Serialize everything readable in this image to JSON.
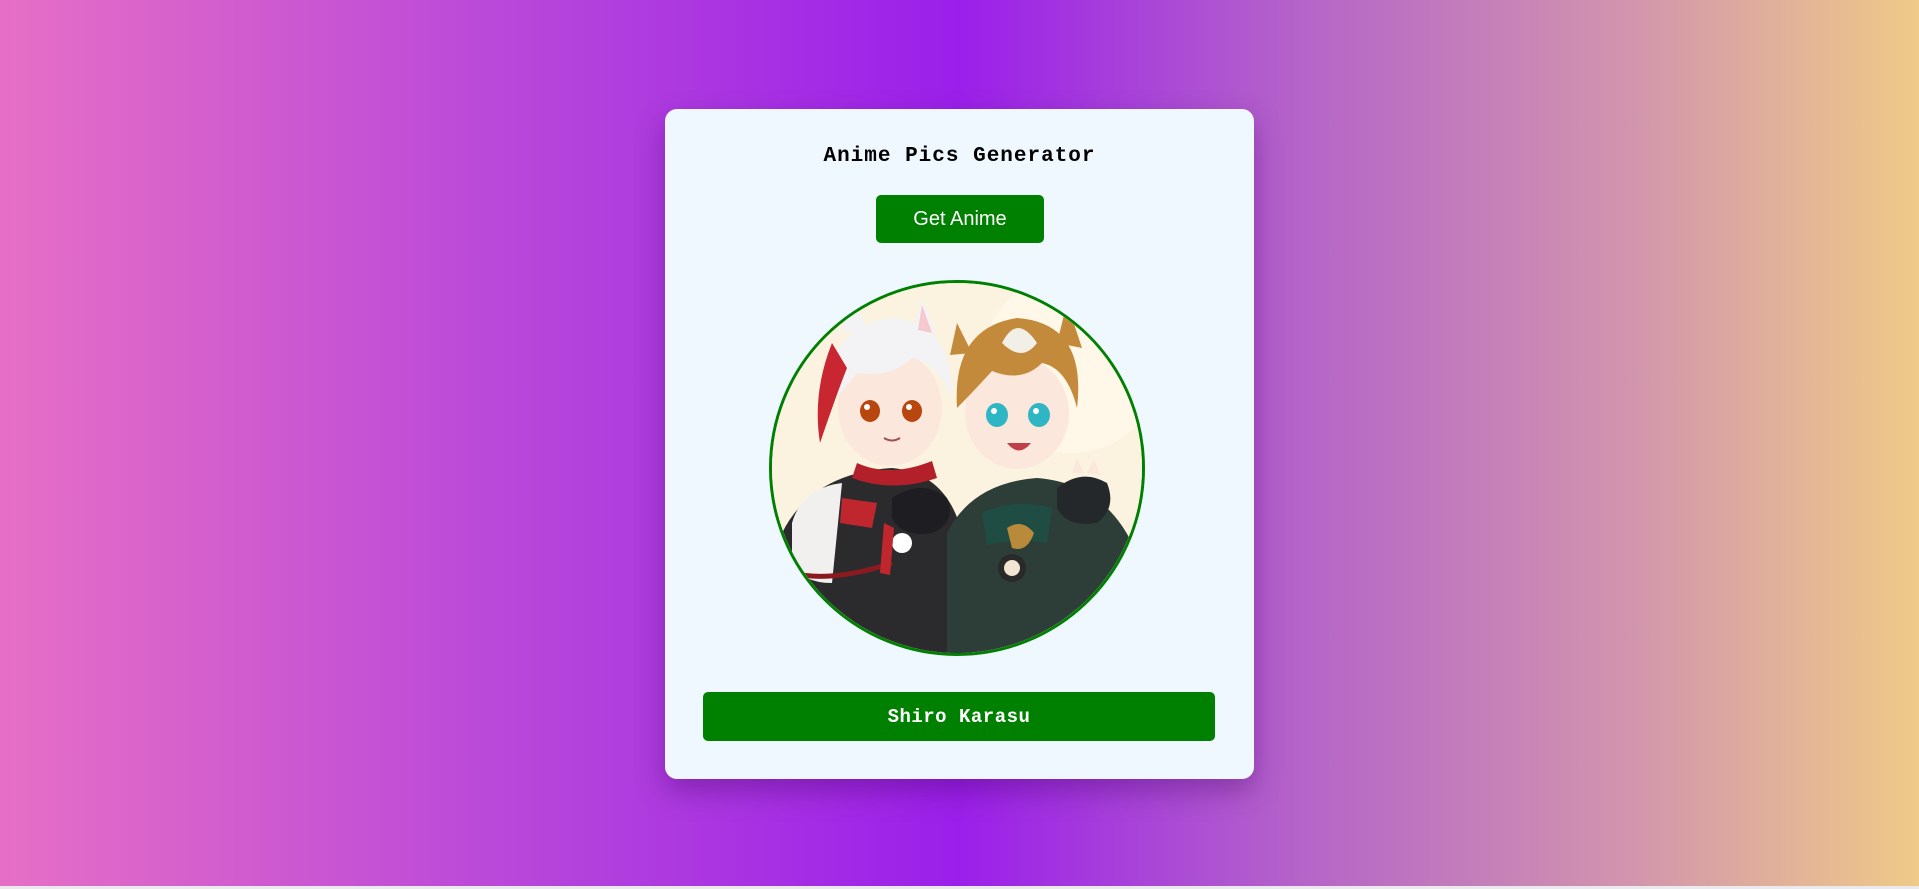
{
  "app": {
    "title": "Anime Pics Generator",
    "get_button_label": "Get Anime",
    "character_name": "Shiro Karasu"
  },
  "image": {
    "alt": "Anime character illustration",
    "subject": "two anime characters with cat ears, one white-and-red haired, one brown-haired with teal eyes"
  },
  "colors": {
    "accent": "#008000",
    "card_background": "#f0f8ff",
    "text_on_accent": "#ffffff"
  }
}
